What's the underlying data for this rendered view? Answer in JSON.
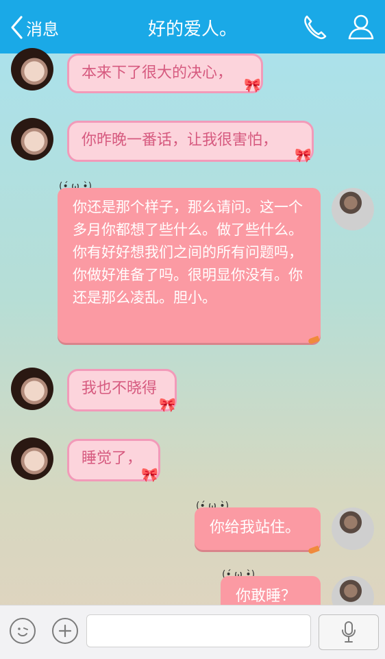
{
  "header": {
    "back_label": "消息",
    "title": "好的爱人。"
  },
  "messages": [
    {
      "side": "left",
      "text": "本来下了很大的决心，"
    },
    {
      "side": "left",
      "text": "你昨晚一番话，让我很害怕，"
    },
    {
      "side": "right",
      "text": "你还是那个样子，那么请问。这一个多月你都想了些什么。做了些什么。你有好好想我们之间的所有问题吗，你做好准备了吗。很明显你没有。你还是那么凌乱。胆小。"
    },
    {
      "side": "left",
      "text": "我也不晓得"
    },
    {
      "side": "left",
      "text": "睡觉了，"
    },
    {
      "side": "right",
      "text": "你给我站住。"
    },
    {
      "side": "right",
      "text": "你敢睡？"
    }
  ],
  "colors": {
    "header_bg": "#1aa9e7",
    "left_bubble_bg": "#fcd4dc",
    "left_bubble_border": "#f29ab9",
    "left_text": "#d65a7f",
    "right_bubble_bg": "#fb9aa3",
    "right_text": "#ffffff"
  },
  "icons": {
    "back": "chevron-left-icon",
    "phone": "phone-icon",
    "profile": "user-icon",
    "emoji": "emoji-icon",
    "plus": "plus-icon",
    "mic": "microphone-icon"
  }
}
